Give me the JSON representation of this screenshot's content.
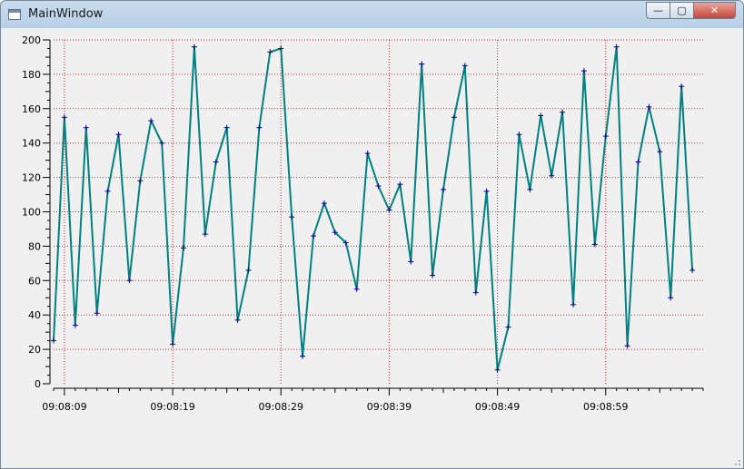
{
  "window": {
    "title": "MainWindow",
    "minimize_glyph": "—",
    "maximize_glyph": "▢",
    "close_glyph": "✕",
    "icon": "app-window-icon"
  },
  "colors": {
    "line": "#008080",
    "marker": "#00008b",
    "grid": "#e02020",
    "canvas": "#f0f0f0",
    "frame": "#f0f0f0"
  },
  "chart_data": {
    "type": "line",
    "title": "",
    "xlabel": "",
    "ylabel": "",
    "ylim": [
      0,
      200
    ],
    "y_major_ticks": [
      0,
      20,
      40,
      60,
      80,
      100,
      120,
      140,
      160,
      180,
      200
    ],
    "y_tick_labels": [
      "0",
      "20",
      "40",
      "60",
      "80",
      "100",
      "120",
      "140",
      "160",
      "180",
      "200"
    ],
    "x_axis_type": "time",
    "xlim": [
      "09:08:08",
      "09:09:08"
    ],
    "x_tick_labels": [
      "09:08:09",
      "09:08:19",
      "09:08:29",
      "09:08:39",
      "09:08:49",
      "09:08:59"
    ],
    "grid": true,
    "grid_style": "dotted",
    "legend": "none",
    "marker": "+",
    "series": [
      {
        "x": [
          "09:08:08",
          "09:08:09",
          "09:08:10",
          "09:08:11",
          "09:08:12",
          "09:08:13",
          "09:08:14",
          "09:08:15",
          "09:08:16",
          "09:08:17",
          "09:08:18",
          "09:08:19",
          "09:08:20",
          "09:08:21",
          "09:08:22",
          "09:08:23",
          "09:08:24",
          "09:08:25",
          "09:08:26",
          "09:08:27",
          "09:08:28",
          "09:08:29",
          "09:08:30",
          "09:08:31",
          "09:08:32",
          "09:08:33",
          "09:08:34",
          "09:08:35",
          "09:08:36",
          "09:08:37",
          "09:08:38",
          "09:08:39",
          "09:08:40",
          "09:08:41",
          "09:08:42",
          "09:08:43",
          "09:08:44",
          "09:08:45",
          "09:08:46",
          "09:08:47",
          "09:08:48",
          "09:08:49",
          "09:08:50",
          "09:08:51",
          "09:08:52",
          "09:08:53",
          "09:08:54",
          "09:08:55",
          "09:08:56",
          "09:08:57",
          "09:08:58",
          "09:08:59",
          "09:09:00",
          "09:09:01",
          "09:09:02",
          "09:09:03",
          "09:09:04",
          "09:09:05",
          "09:09:06",
          "09:09:07"
        ],
        "y": [
          25,
          155,
          34,
          149,
          41,
          112,
          145,
          60,
          118,
          153,
          140,
          23,
          79,
          196,
          87,
          129,
          149,
          37,
          66,
          149,
          193,
          195,
          97,
          16,
          86,
          105,
          88,
          82,
          55,
          134,
          115,
          101,
          116,
          71,
          186,
          63,
          113,
          155,
          185,
          53,
          112,
          8,
          33,
          145,
          113,
          156,
          121,
          158,
          46,
          182,
          81,
          144,
          196,
          22,
          129,
          161,
          135,
          50,
          173,
          66
        ]
      }
    ]
  }
}
